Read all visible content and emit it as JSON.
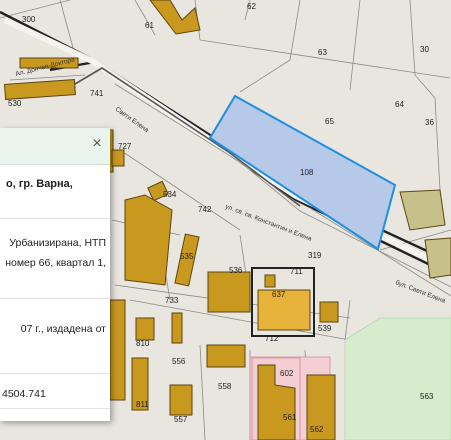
{
  "map": {
    "selected_parcel": "108",
    "parcel_labels": [
      "300",
      "61",
      "62",
      "63",
      "64",
      "65",
      "30",
      "36",
      "108",
      "741",
      "530",
      "727",
      "534",
      "742",
      "535",
      "536",
      "711",
      "637",
      "539",
      "733",
      "712",
      "810",
      "556",
      "811",
      "557",
      "558",
      "602",
      "561",
      "562",
      "563",
      "319"
    ],
    "street_labels": {
      "tramline_left": "Ал. Дончев-Доктора",
      "main_street": "ул. св. св. Константин и Елена",
      "small_street": "Свети Елена",
      "bottom_right_street": "бул. Свети Елена"
    },
    "colors": {
      "building": "#c9981f",
      "selected_fill": "#b7c9e9",
      "selected_stroke": "#1e8fe0",
      "green_area": "#d6eccd"
    }
  },
  "info_panel": {
    "title": "о, гр. Варна,",
    "line_1": "Урбанизирана,  НТП",
    "line_2": "номер 66, квартал 1,",
    "line_3": "07 г.,  издадена  от",
    "line_4": "",
    "line_5": "4504.741",
    "close_icon": "×"
  }
}
